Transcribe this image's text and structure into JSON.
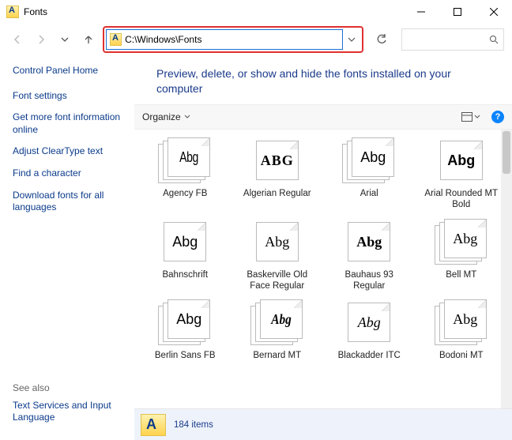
{
  "window": {
    "title": "Fonts"
  },
  "nav": {
    "address": "C:\\Windows\\Fonts"
  },
  "sidebar": {
    "home": "Control Panel Home",
    "links": [
      "Font settings",
      "Get more font information online",
      "Adjust ClearType text",
      "Find a character",
      "Download fonts for all languages"
    ],
    "see_also_label": "See also",
    "see_also_links": [
      "Text Services and Input Language"
    ]
  },
  "main": {
    "heading": "Preview, delete, or show and hide the fonts installed on your computer",
    "organize_label": "Organize"
  },
  "fonts": [
    {
      "label": "Agency FB",
      "sample": "Abg",
      "stack": true,
      "cls": "fv-narrow"
    },
    {
      "label": "Algerian Regular",
      "sample": "ABG",
      "stack": false,
      "cls": "fv-algerian"
    },
    {
      "label": "Arial",
      "sample": "Abg",
      "stack": true,
      "cls": "fv-arial"
    },
    {
      "label": "Arial Rounded MT Bold",
      "sample": "Abg",
      "stack": false,
      "cls": "fv-arialr"
    },
    {
      "label": "Bahnschrift",
      "sample": "Abg",
      "stack": false,
      "cls": "fv-bahn"
    },
    {
      "label": "Baskerville Old Face Regular",
      "sample": "Abg",
      "stack": false,
      "cls": "fv-bask"
    },
    {
      "label": "Bauhaus 93 Regular",
      "sample": "Abg",
      "stack": false,
      "cls": "fv-bauhaus"
    },
    {
      "label": "Bell MT",
      "sample": "Abg",
      "stack": true,
      "cls": "fv-bell"
    },
    {
      "label": "Berlin Sans FB",
      "sample": "Abg",
      "stack": true,
      "cls": "fv-berlin"
    },
    {
      "label": "Bernard MT",
      "sample": "Abg",
      "stack": true,
      "cls": "fv-bernard"
    },
    {
      "label": "Blackadder ITC",
      "sample": "Abg",
      "stack": false,
      "cls": "fv-black"
    },
    {
      "label": "Bodoni MT",
      "sample": "Abg",
      "stack": true,
      "cls": "fv-bodoni"
    }
  ],
  "status": {
    "count_text": "184 items"
  }
}
